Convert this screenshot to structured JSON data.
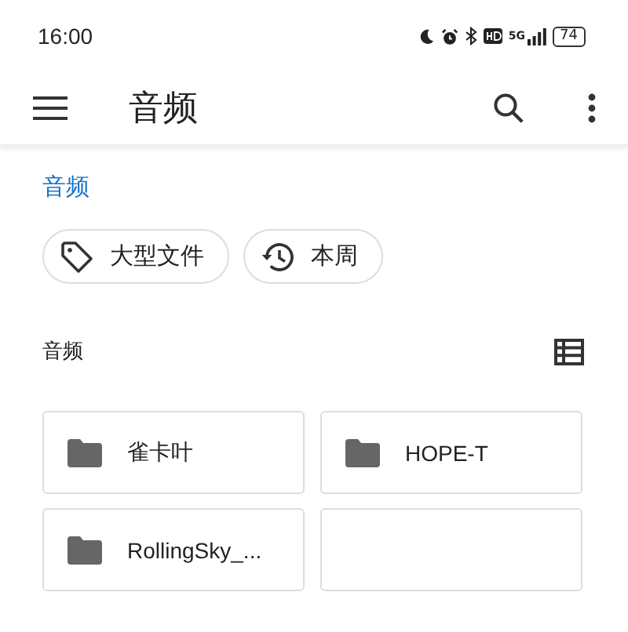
{
  "status_bar": {
    "time": "16:00",
    "network": "5G",
    "battery": "74"
  },
  "toolbar": {
    "title": "音频"
  },
  "breadcrumb": "音频",
  "chips": [
    {
      "label": "大型文件",
      "kind": "tag"
    },
    {
      "label": "本周",
      "kind": "history"
    }
  ],
  "section": {
    "title": "音频"
  },
  "folders": [
    {
      "kind": "folder",
      "name": "雀卡叶"
    },
    {
      "kind": "folder",
      "name": "HOPE-T"
    },
    {
      "kind": "folder",
      "name": "RollingSky_..."
    },
    {
      "kind": "blank"
    }
  ]
}
